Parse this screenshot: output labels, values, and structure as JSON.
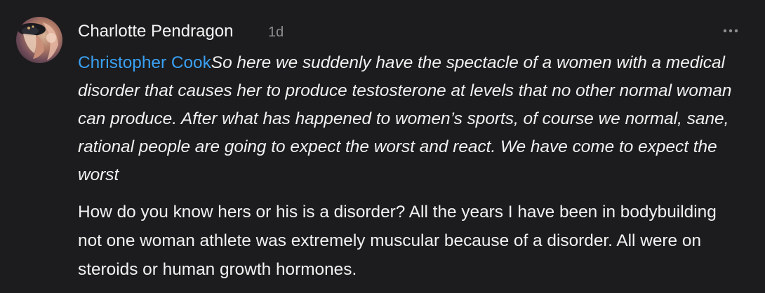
{
  "comment": {
    "author": "Charlotte Pendragon",
    "timestamp": "1d",
    "more_icon": "more-horizontal-icon",
    "mention": "Christopher Cook",
    "quoted_text": "So here we suddenly have the spectacle of a women with a medical disorder that causes her to produce testosterone at levels that no other normal woman can produce. After what has happened to women’s sports, of course we normal, sane, rational people are going to expect the worst and react. We have come to expect the worst",
    "reply_text": "How do you know hers or his is a disorder? All the years I have been in bodybuilding not one woman athlete was extremely muscular because of a disorder. All were on steroids or human growth hormones."
  },
  "colors": {
    "background": "#1c1c1e",
    "text": "#f2f2f2",
    "mention": "#3aa0f2",
    "muted": "#8e8e93"
  }
}
